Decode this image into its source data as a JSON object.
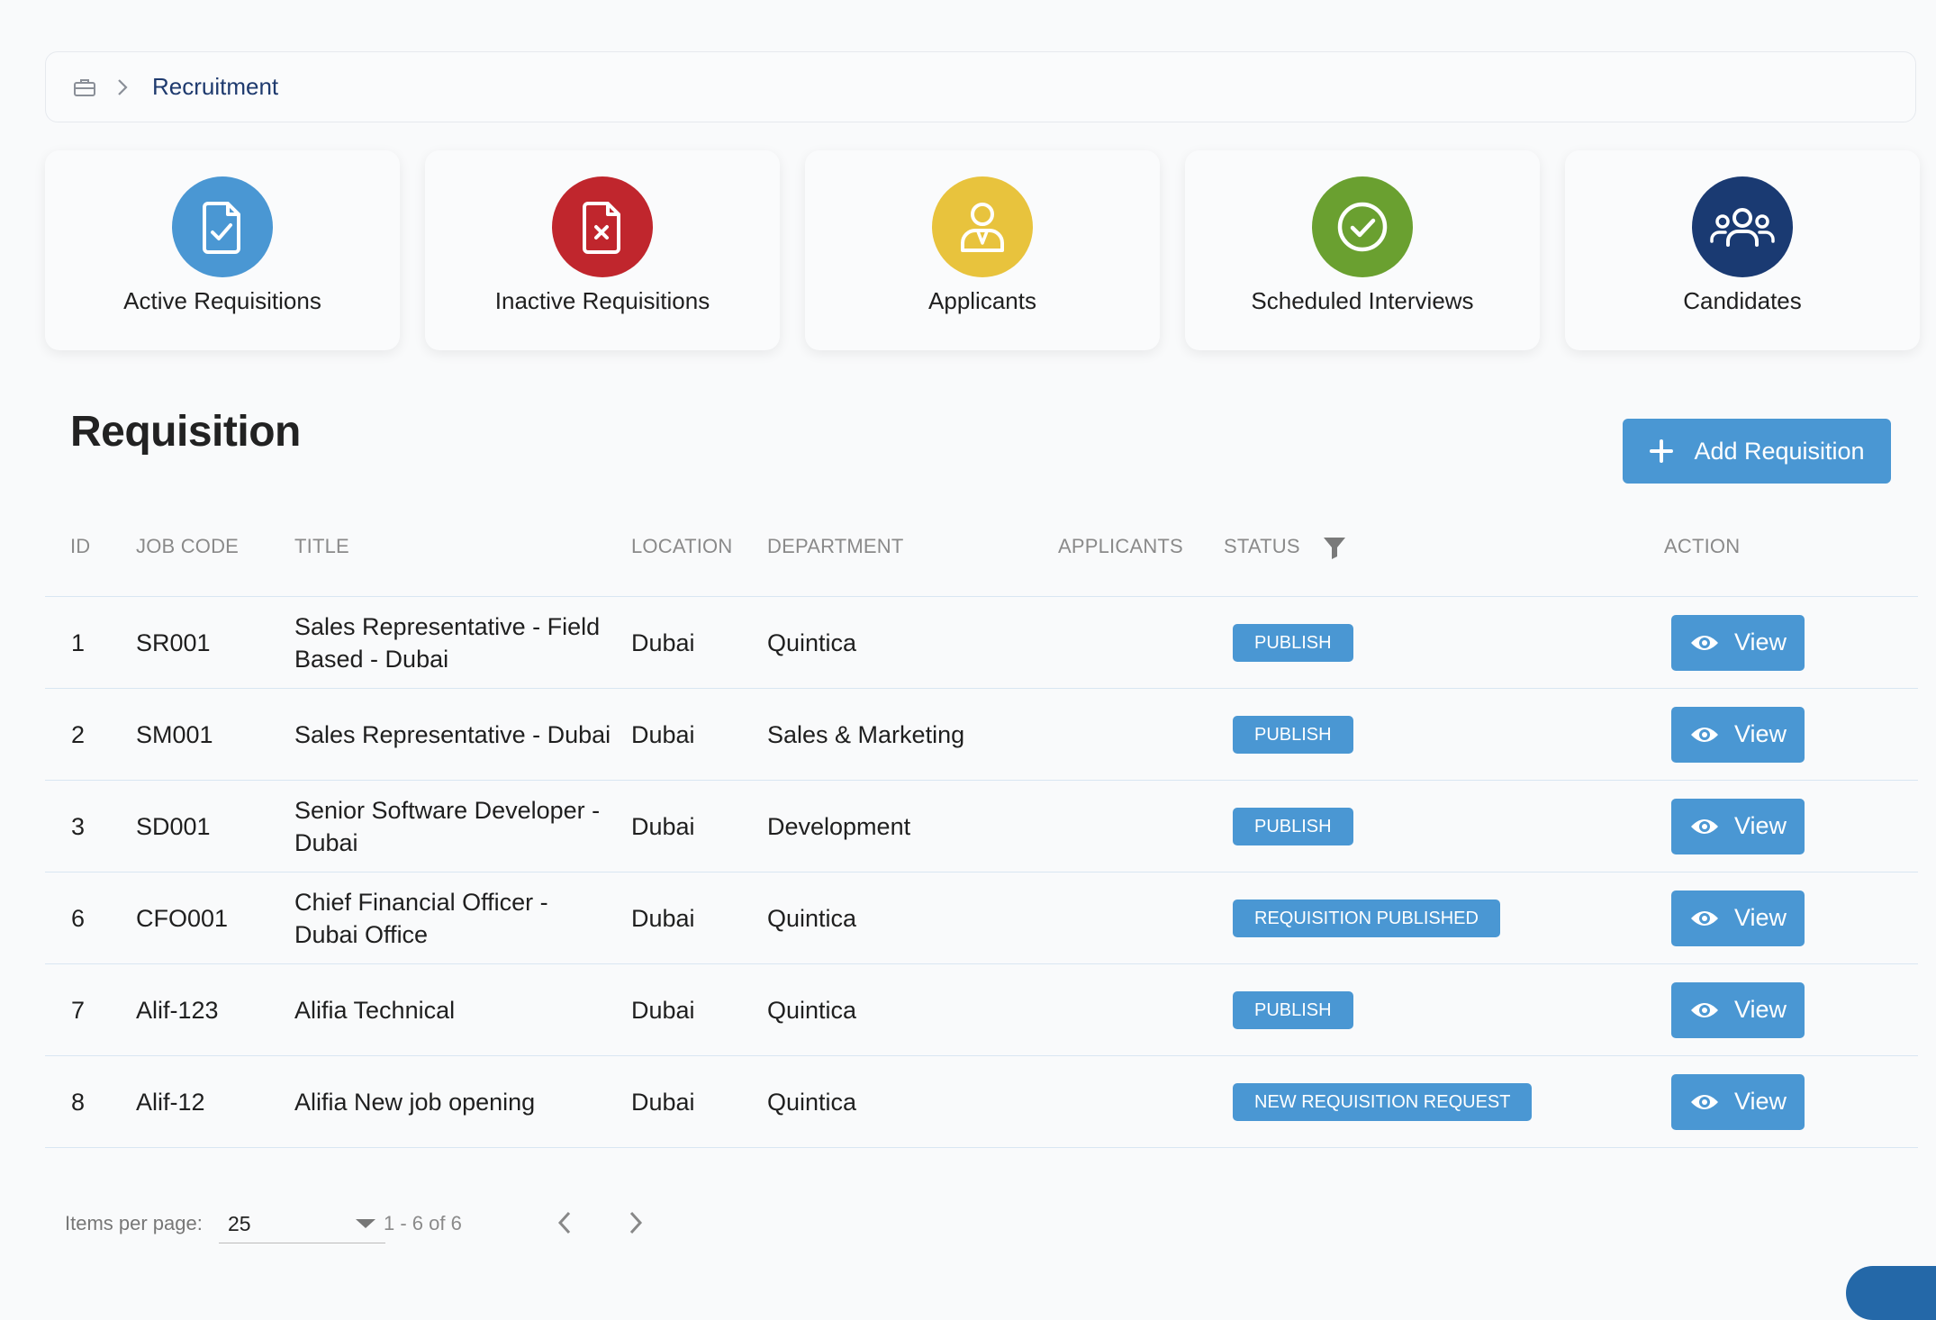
{
  "breadcrumb": {
    "home_icon": "briefcase-icon",
    "separator_icon": "chevron-right-icon",
    "current": "Recruitment"
  },
  "cards": [
    {
      "label": "Active Requisitions",
      "icon": "file-check-icon",
      "color": "#4a97d3"
    },
    {
      "label": "Inactive Requisitions",
      "icon": "file-x-icon",
      "color": "#c0262d"
    },
    {
      "label": "Applicants",
      "icon": "user-icon",
      "color": "#e8c33d"
    },
    {
      "label": "Scheduled Interviews",
      "icon": "check-circle-icon",
      "color": "#6aa030"
    },
    {
      "label": "Candidates",
      "icon": "users-group-icon",
      "color": "#1a3a72"
    }
  ],
  "section": {
    "title": "Requisition",
    "add_button_label": "Add Requisition"
  },
  "table": {
    "headers": {
      "id": "ID",
      "job_code": "JOB CODE",
      "title": "TITLE",
      "location": "LOCATION",
      "department": "DEPARTMENT",
      "applicants": "APPLICANTS",
      "status": "STATUS",
      "action": "ACTION"
    },
    "rows": [
      {
        "id": "1",
        "job_code": "SR001",
        "title": [
          "Sales Representative - Field",
          "Based - Dubai"
        ],
        "location": "Dubai",
        "department": "Quintica",
        "applicants": "",
        "status": "PUBLISH",
        "action": "View"
      },
      {
        "id": "2",
        "job_code": "SM001",
        "title": [
          "Sales Representative - Dubai"
        ],
        "location": "Dubai",
        "department": "Sales & Marketing",
        "applicants": "",
        "status": "PUBLISH",
        "action": "View"
      },
      {
        "id": "3",
        "job_code": "SD001",
        "title": [
          "Senior Software Developer -",
          "Dubai"
        ],
        "location": "Dubai",
        "department": "Development",
        "applicants": "",
        "status": "PUBLISH",
        "action": "View"
      },
      {
        "id": "6",
        "job_code": "CFO001",
        "title": [
          "Chief Financial Officer -",
          "Dubai Office"
        ],
        "location": "Dubai",
        "department": "Quintica",
        "applicants": "",
        "status": "REQUISITION PUBLISHED",
        "action": "View"
      },
      {
        "id": "7",
        "job_code": "Alif-123",
        "title": [
          "Alifia Technical"
        ],
        "location": "Dubai",
        "department": "Quintica",
        "applicants": "",
        "status": "PUBLISH",
        "action": "View"
      },
      {
        "id": "8",
        "job_code": "Alif-12",
        "title": [
          "Alifia New job opening"
        ],
        "location": "Dubai",
        "department": "Quintica",
        "applicants": "",
        "status": "NEW REQUISITION REQUEST",
        "action": "View"
      }
    ]
  },
  "pagination": {
    "items_per_page_label": "Items per page:",
    "items_per_page_value": "25",
    "range": "1 - 6 of 6"
  },
  "colors": {
    "primary": "#4a97d3",
    "breadcrumb_text": "#1e3a6e"
  }
}
